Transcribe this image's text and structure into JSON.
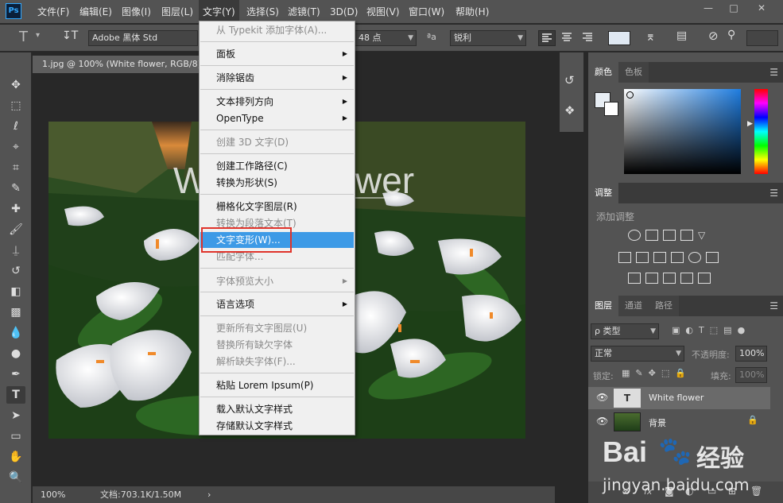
{
  "app": {
    "logo": "Ps"
  },
  "menubar": [
    "文件(F)",
    "编辑(E)",
    "图像(I)",
    "图层(L)",
    "文字(Y)",
    "选择(S)",
    "滤镜(T)",
    "3D(D)",
    "视图(V)",
    "窗口(W)",
    "帮助(H)"
  ],
  "window_controls": {
    "minimize": "—",
    "restore": "□",
    "close": "✕"
  },
  "options": {
    "font_family": "Adobe 黑体 Std",
    "font_size": "48 点",
    "aa_icon": "ªa",
    "antialias": "锐利"
  },
  "document": {
    "tab_title": "1.jpg @ 100% (White flower, RGB/8)",
    "overlay_text": "White flower",
    "overlay_visible_left": "W",
    "overlay_visible_right": "wer"
  },
  "status": {
    "zoom": "100%",
    "doc_info": "文档:703.1K/1.50M",
    "arrow": "›"
  },
  "dropdown": [
    {
      "label": "从 Typekit 添加字体(A)...",
      "disabled": true,
      "submenu": false
    },
    {
      "label": "面板",
      "disabled": false,
      "submenu": true
    },
    {
      "label": "消除锯齿",
      "disabled": false,
      "submenu": true
    },
    {
      "label": "文本排列方向",
      "disabled": false,
      "submenu": true
    },
    {
      "label": "OpenType",
      "disabled": false,
      "submenu": true
    },
    {
      "label": "创建 3D 文字(D)",
      "disabled": true,
      "submenu": false
    },
    {
      "label": "创建工作路径(C)",
      "disabled": false,
      "submenu": false
    },
    {
      "label": "转换为形状(S)",
      "disabled": false,
      "submenu": false
    },
    {
      "label": "栅格化文字图层(R)",
      "disabled": false,
      "submenu": false
    },
    {
      "label": "转换为段落文本(T)",
      "disabled": true,
      "submenu": false
    },
    {
      "label": "文字变形(W)...",
      "disabled": false,
      "submenu": false,
      "highlighted": true
    },
    {
      "label": "匹配字体...",
      "disabled": true,
      "submenu": false
    },
    {
      "label": "字体预览大小",
      "disabled": true,
      "submenu": true
    },
    {
      "label": "语言选项",
      "disabled": false,
      "submenu": true
    },
    {
      "label": "更新所有文字图层(U)",
      "disabled": true,
      "submenu": false
    },
    {
      "label": "替换所有缺欠字体",
      "disabled": true,
      "submenu": false
    },
    {
      "label": "解析缺失字体(F)...",
      "disabled": true,
      "submenu": false
    },
    {
      "label": "粘贴 Lorem Ipsum(P)",
      "disabled": false,
      "submenu": false
    },
    {
      "label": "载入默认文字样式",
      "disabled": false,
      "submenu": false
    },
    {
      "label": "存储默认文字样式",
      "disabled": false,
      "submenu": false
    }
  ],
  "color_panel": {
    "tabs": [
      "颜色",
      "色板"
    ],
    "hue_hex": "#1f7de0"
  },
  "adjust_panel": {
    "tab": "调整",
    "hint": "添加调整"
  },
  "layers_panel": {
    "tabs": [
      "图层",
      "通道",
      "路径"
    ],
    "filter_label": "ρ 类型",
    "blend_mode": "正常",
    "opacity_label": "不透明度:",
    "opacity_value": "100%",
    "lock_label": "锁定:",
    "fill_label": "填充:",
    "fill_value": "100%",
    "layers": [
      {
        "name": "White flower",
        "type": "text",
        "thumb": "T"
      },
      {
        "name": "背景",
        "type": "image"
      }
    ],
    "footer_icons": [
      "∞",
      "fx"
    ]
  },
  "watermark": {
    "brand": "Bai",
    "brand2": "经验",
    "url": "jingyan.baidu.com"
  },
  "colors": {
    "highlight": "#3d9ae6",
    "callout": "#e0342b",
    "panel": "#535353"
  }
}
